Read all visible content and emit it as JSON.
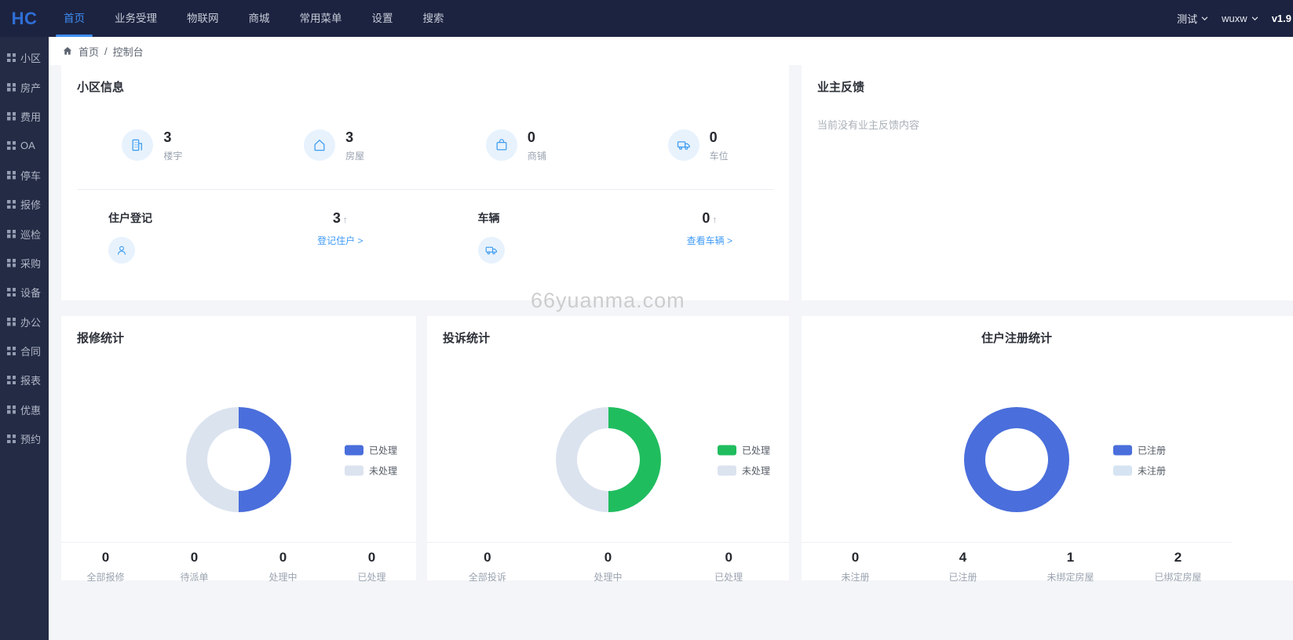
{
  "navbar": {
    "logo": "HC",
    "menu": [
      "首页",
      "业务受理",
      "物联网",
      "商城",
      "常用菜单",
      "设置",
      "搜索"
    ],
    "community_switcher": "测试",
    "username": "wuxw",
    "version": "v1.9"
  },
  "sidebar": {
    "items": [
      "小区",
      "房产",
      "费用",
      "OA",
      "停车",
      "报修",
      "巡检",
      "采购",
      "设备",
      "办公",
      "合同",
      "报表",
      "优惠",
      "预约"
    ]
  },
  "breadcrumb": {
    "home": "首页",
    "separator": "/",
    "current": "控制台"
  },
  "community_card": {
    "title": "小区信息",
    "stats": [
      {
        "icon": "building-icon",
        "value": "3",
        "label": "楼宇"
      },
      {
        "icon": "house-icon",
        "value": "3",
        "label": "房屋"
      },
      {
        "icon": "bag-icon",
        "value": "0",
        "label": "商铺"
      },
      {
        "icon": "truck-icon",
        "value": "0",
        "label": "车位"
      }
    ],
    "registration": {
      "title": "住户登记",
      "value": "3",
      "link": "登记住户 >"
    },
    "vehicle": {
      "title": "车辆",
      "value": "0",
      "link": "查看车辆 >"
    }
  },
  "feedback_card": {
    "title": "业主反馈",
    "empty_text": "当前没有业主反馈内容"
  },
  "watermark": "66yuanma.com",
  "charts": [
    {
      "title": "报修统计",
      "legend": [
        {
          "label": "已处理",
          "color": "#4a6edb"
        },
        {
          "label": "未处理",
          "color": "#dbe3ef"
        }
      ],
      "stats": [
        {
          "value": "0",
          "label": "全部报修"
        },
        {
          "value": "0",
          "label": "待派单"
        },
        {
          "value": "0",
          "label": "处理中"
        },
        {
          "value": "0",
          "label": "已处理"
        }
      ]
    },
    {
      "title": "投诉统计",
      "legend": [
        {
          "label": "已处理",
          "color": "#20bd5f"
        },
        {
          "label": "未处理",
          "color": "#dbe3ef"
        }
      ],
      "stats": [
        {
          "value": "0",
          "label": "全部投诉"
        },
        {
          "value": "0",
          "label": "处理中"
        },
        {
          "value": "0",
          "label": "已处理"
        }
      ]
    },
    {
      "title": "住户注册统计",
      "legend": [
        {
          "label": "已注册",
          "color": "#4a6edb"
        },
        {
          "label": "未注册",
          "color": "#d6e3f2"
        }
      ],
      "stats": [
        {
          "value": "0",
          "label": "未注册"
        },
        {
          "value": "4",
          "label": "已注册"
        },
        {
          "value": "1",
          "label": "未绑定房屋"
        },
        {
          "value": "2",
          "label": "已绑定房屋"
        }
      ]
    }
  ],
  "chart_data": [
    {
      "type": "pie",
      "title": "报修统计",
      "labels": [
        "已处理",
        "未处理"
      ],
      "values": [
        50,
        50
      ],
      "colors": [
        "#4a6edb",
        "#dbe3ef"
      ],
      "legend_position": "right",
      "donut": true
    },
    {
      "type": "pie",
      "title": "投诉统计",
      "labels": [
        "已处理",
        "未处理"
      ],
      "values": [
        50,
        50
      ],
      "colors": [
        "#20bd5f",
        "#dbe3ef"
      ],
      "legend_position": "right",
      "donut": true
    },
    {
      "type": "pie",
      "title": "住户注册统计",
      "labels": [
        "已注册",
        "未注册"
      ],
      "values": [
        100,
        0
      ],
      "colors": [
        "#4a6edb",
        "#d6e3f2"
      ],
      "legend_position": "right",
      "donut": true
    }
  ]
}
